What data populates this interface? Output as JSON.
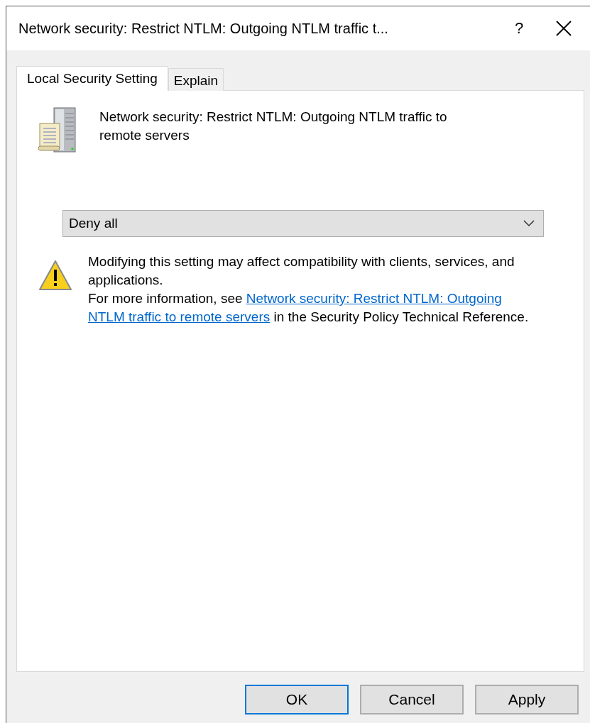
{
  "window": {
    "title": "Network security: Restrict NTLM: Outgoing NTLM traffic t...",
    "help": "?"
  },
  "tabs": [
    {
      "label": "Local Security Setting",
      "selected": true
    },
    {
      "label": "Explain",
      "selected": false
    }
  ],
  "policy_name": "Network security: Restrict NTLM: Outgoing NTLM traffic to remote servers",
  "dropdown": {
    "value": "Deny all"
  },
  "warning": {
    "text": "Modifying this setting may affect compatibility with clients, services, and applications.",
    "more_prefix": "For more information, see ",
    "link_lines": [
      "Network security: Restrict NTLM: Outgoing",
      "NTLM traffic to remote servers"
    ],
    "more_suffix": " in the Security Policy Technical Reference."
  },
  "buttons": [
    {
      "label": "OK",
      "default": true
    },
    {
      "label": "Cancel",
      "default": false
    },
    {
      "label": "Apply",
      "default": false
    }
  ]
}
